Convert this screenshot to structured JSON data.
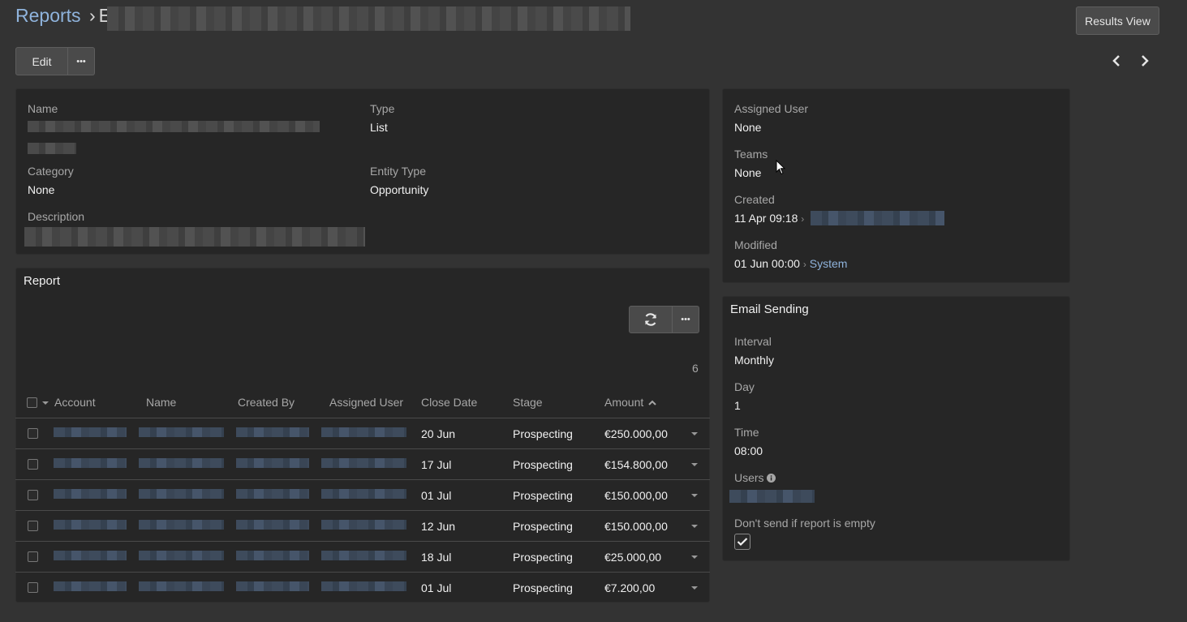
{
  "header": {
    "breadcrumb_root": "Reports",
    "breadcrumb_sep": "›",
    "breadcrumb_current_initial": "E",
    "results_view_label": "Results View",
    "edit_label": "Edit",
    "more_label": "•••"
  },
  "details": {
    "name_label": "Name",
    "type_label": "Type",
    "type_value": "List",
    "category_label": "Category",
    "category_value": "None",
    "entity_type_label": "Entity Type",
    "entity_type_value": "Opportunity",
    "description_label": "Description"
  },
  "side": {
    "assigned_user_label": "Assigned User",
    "assigned_user_value": "None",
    "teams_label": "Teams",
    "teams_value": "None",
    "created_label": "Created",
    "created_value": "11 Apr 09:18",
    "modified_label": "Modified",
    "modified_value": "01 Jun 00:00",
    "modified_by": "System",
    "sep": "›"
  },
  "email": {
    "title": "Email Sending",
    "interval_label": "Interval",
    "interval_value": "Monthly",
    "day_label": "Day",
    "day_value": "1",
    "time_label": "Time",
    "time_value": "08:00",
    "users_label": "Users",
    "empty_label": "Don't send if report is empty",
    "empty_checked": true
  },
  "report": {
    "title": "Report",
    "count": "6",
    "columns": [
      "Account",
      "Name",
      "Created By",
      "Assigned User",
      "Close Date",
      "Stage",
      "Amount"
    ],
    "rows": [
      {
        "close_date": "20 Jun",
        "stage": "Prospecting",
        "amount": "€250.000,00"
      },
      {
        "close_date": "17 Jul",
        "stage": "Prospecting",
        "amount": "€154.800,00"
      },
      {
        "close_date": "01 Jul",
        "stage": "Prospecting",
        "amount": "€150.000,00"
      },
      {
        "close_date": "12 Jun",
        "stage": "Prospecting",
        "amount": "€150.000,00"
      },
      {
        "close_date": "18 Jul",
        "stage": "Prospecting",
        "amount": "€25.000,00"
      },
      {
        "close_date": "01 Jul",
        "stage": "Prospecting",
        "amount": "€7.200,00"
      }
    ]
  },
  "colors": {
    "background": "#333333",
    "panel": "#262626",
    "link": "#8fb3dc"
  }
}
